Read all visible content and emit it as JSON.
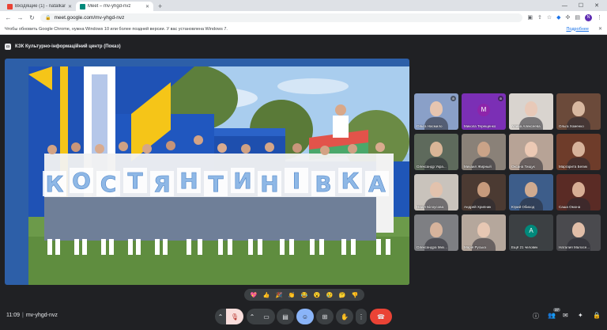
{
  "browser": {
    "tabs": [
      {
        "title": "Входящие (1) - natalkamalakaud@g...",
        "favicon_color": "#ea4335"
      },
      {
        "title": "Meet – mv-yhgd-nvz",
        "favicon_color": "#00897b"
      }
    ],
    "new_tab": "+",
    "url": "meet.google.com/mv-yhgd-nvz",
    "profile_initial": "N"
  },
  "infobar": {
    "message": "Чтобы обновить Google Chrome, нужна Windows 10 или более поздней версии. У вас установлена Windows 7.",
    "link": "Подробнее"
  },
  "meet": {
    "presenter_label": "КЗК Культурно-інформаційний центр (Показ)",
    "photo_letters": [
      "К",
      "О",
      "С",
      "Т",
      "Я",
      "Н",
      "Т",
      "И",
      "Н",
      "І",
      "В",
      "К",
      "А"
    ],
    "participants": [
      {
        "name": "Ольга Насмило",
        "skin": "#e6c5b0",
        "bg": "#8aa0c8",
        "muted": true
      },
      {
        "name": "Микола Терещенко",
        "avatar": "M",
        "avatar_color": "#8e24aa",
        "bg": "#7b2fb5",
        "muted": true
      },
      {
        "name": "Алина Алексеева",
        "skin": "#e8c9b8",
        "bg": "#d9d4cf",
        "muted": false
      },
      {
        "name": "Ольга Хоменко",
        "skin": "#d8b8a0",
        "bg": "#6b4a3a",
        "muted": false
      },
      {
        "name": "Олександр Укра...",
        "skin": "#d9b597",
        "bg": "#5e6a5c",
        "muted": false
      },
      {
        "name": "Михаил Жирный",
        "skin": "#caa388",
        "bg": "#8a8178",
        "muted": false
      },
      {
        "name": "Оксана Тищук",
        "skin": "#ecc9b4",
        "bg": "#b7a396",
        "muted": false
      },
      {
        "name": "Маргарита Белик",
        "skin": "#d7b39b",
        "bg": "#6e3c2a",
        "muted": false
      },
      {
        "name": "Надія Білоусова",
        "skin": "#e2c2ad",
        "bg": "#c9c3bc",
        "muted": false
      },
      {
        "name": "Андрей Хрипник",
        "skin": "#c69a7c",
        "bg": "#4b3a32",
        "muted": false
      },
      {
        "name": "Юрий Обиход",
        "skin": "#d0ab90",
        "bg": "#3d5d8a",
        "muted": false
      },
      {
        "name": "Саша Омона",
        "skin": "#d8ae95",
        "bg": "#5a2b25",
        "muted": false
      },
      {
        "name": "Олександра Мих...",
        "skin": "#d6b39c",
        "bg": "#7e7f83",
        "muted": false
      },
      {
        "name": "Марія Руська",
        "skin": "#e7c7b3",
        "bg": "#b5a79c",
        "muted": false
      },
      {
        "name": "Ещё 21 человек",
        "avatar": "A",
        "avatar_color": "#00897b",
        "bg": "#3c4043",
        "muted": false
      },
      {
        "name": "Наталия Малосе...",
        "skin": "#e1bea8",
        "bg": "#4a4a4e",
        "muted": false
      }
    ],
    "reactions": [
      "💖",
      "👍",
      "🎉",
      "👏",
      "😂",
      "😮",
      "😢",
      "🤔",
      "👎"
    ],
    "time": "11:09",
    "meeting_code": "mv-yhgd-nvz",
    "participant_count": "37"
  }
}
